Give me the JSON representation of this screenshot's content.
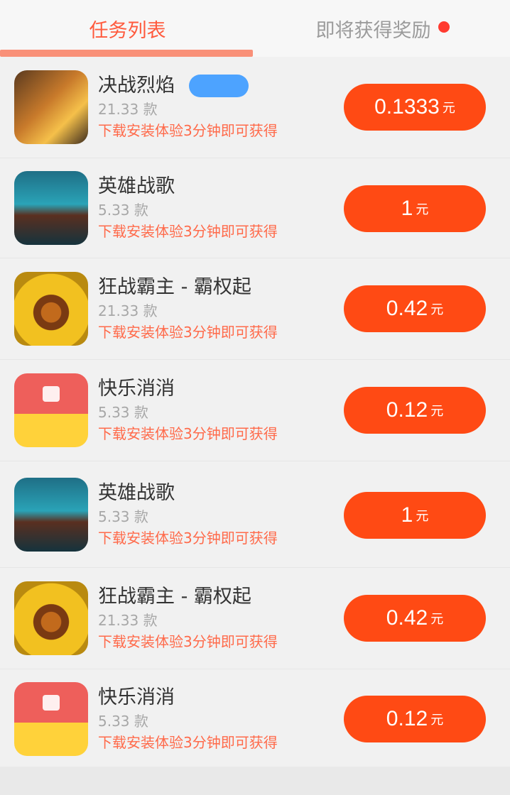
{
  "tabs": [
    {
      "label": "任务列表",
      "active": true
    },
    {
      "label": "即将获得奖励",
      "active": false,
      "dot": true
    }
  ],
  "colors": {
    "accent": "#ff4a14",
    "tab_active": "#ff5a3d",
    "badge": "#4da3ff",
    "desc": "#ff6a4a"
  },
  "tasks": [
    {
      "name": "决战烈焰",
      "badge": true,
      "sub": "21.33 款",
      "desc": "下载安装体验3分钟即可获得",
      "reward": "0.1333",
      "unit": "元",
      "icon": "game-warrior-icon"
    },
    {
      "name": "英雄战歌",
      "badge": false,
      "sub": "5.33 款",
      "desc": "下载安装体验3分钟即可获得",
      "reward": "1",
      "unit": "元",
      "icon": "game-fighter-icon"
    },
    {
      "name": "狂战霸主 - 霸权起",
      "badge": false,
      "sub": "21.33 款",
      "desc": "下载安装体验3分钟即可获得",
      "reward": "0.42",
      "unit": "元",
      "icon": "game-lion-icon"
    },
    {
      "name": "快乐消消",
      "badge": false,
      "sub": "5.33 款",
      "desc": "下载安装体验3分钟即可获得",
      "reward": "0.12",
      "unit": "元",
      "icon": "game-puzzle-icon"
    },
    {
      "name": "英雄战歌",
      "badge": false,
      "sub": "5.33 款",
      "desc": "下载安装体验3分钟即可获得",
      "reward": "1",
      "unit": "元",
      "icon": "game-fighter-icon"
    },
    {
      "name": "狂战霸主 - 霸权起",
      "badge": false,
      "sub": "21.33 款",
      "desc": "下载安装体验3分钟即可获得",
      "reward": "0.42",
      "unit": "元",
      "icon": "game-lion-icon"
    },
    {
      "name": "快乐消消",
      "badge": false,
      "sub": "5.33 款",
      "desc": "下载安装体验3分钟即可获得",
      "reward": "0.12",
      "unit": "元",
      "icon": "game-puzzle-icon"
    }
  ]
}
